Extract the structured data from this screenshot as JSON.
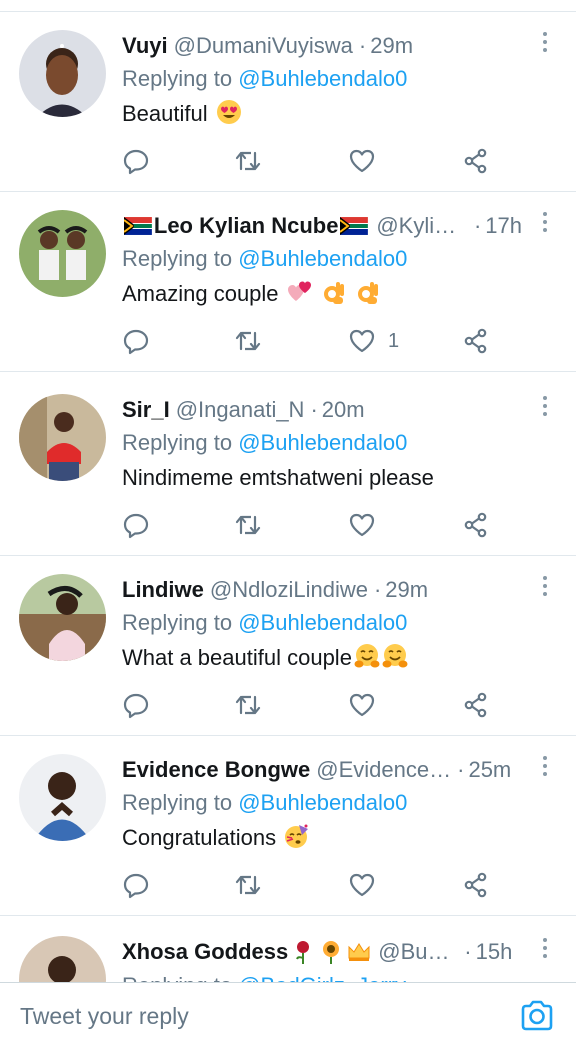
{
  "reply_prefix": "Replying to",
  "tweets": [
    {
      "name": "Vuyi",
      "handle": "@DumaniVuyiswa",
      "time": "29m",
      "reply_to": "@Buhlebendalo0",
      "text": "Beautiful",
      "emoji": [
        "heart-eyes-emoji"
      ],
      "like_count": ""
    },
    {
      "name": "Leo Kylian Ncube",
      "handle": "@Kylia…",
      "time": "17h",
      "reply_to": "@Buhlebendalo0",
      "text": "Amazing couple",
      "emoji": [
        "two-hearts-emoji",
        "ok-hand-emoji",
        "ok-hand-emoji"
      ],
      "like_count": "1"
    },
    {
      "name": "Sir_I",
      "handle": "@Inganati_N",
      "time": "20m",
      "reply_to": "@Buhlebendalo0",
      "text": "Nindimeme emtshatweni please",
      "emoji": [],
      "like_count": ""
    },
    {
      "name": "Lindiwe",
      "handle": "@NdloziLindiwe",
      "time": "29m",
      "reply_to": "@Buhlebendalo0",
      "text": "What a beautiful couple",
      "emoji": [
        "hugging-emoji",
        "hugging-emoji"
      ],
      "like_count": ""
    },
    {
      "name": "Evidence Bongwe",
      "handle": "@Evidence…",
      "time": "25m",
      "reply_to": "@Buhlebendalo0",
      "text": "Congratulations",
      "emoji": [
        "party-face-emoji"
      ],
      "like_count": ""
    },
    {
      "name": "Xhosa Goddess",
      "handle": "@Buh…",
      "time": "15h",
      "reply_to": "@BadGirlz_Jerry",
      "text": "",
      "emoji": [
        "rose-emoji",
        "sunflower-emoji",
        "crown-emoji"
      ],
      "like_count": ""
    }
  ],
  "compose": {
    "placeholder": "Tweet your reply",
    "icon": "camera-icon"
  },
  "colors": {
    "accent": "#1da1f2",
    "secondary_text": "#657786",
    "divider": "#e1e8ed"
  }
}
